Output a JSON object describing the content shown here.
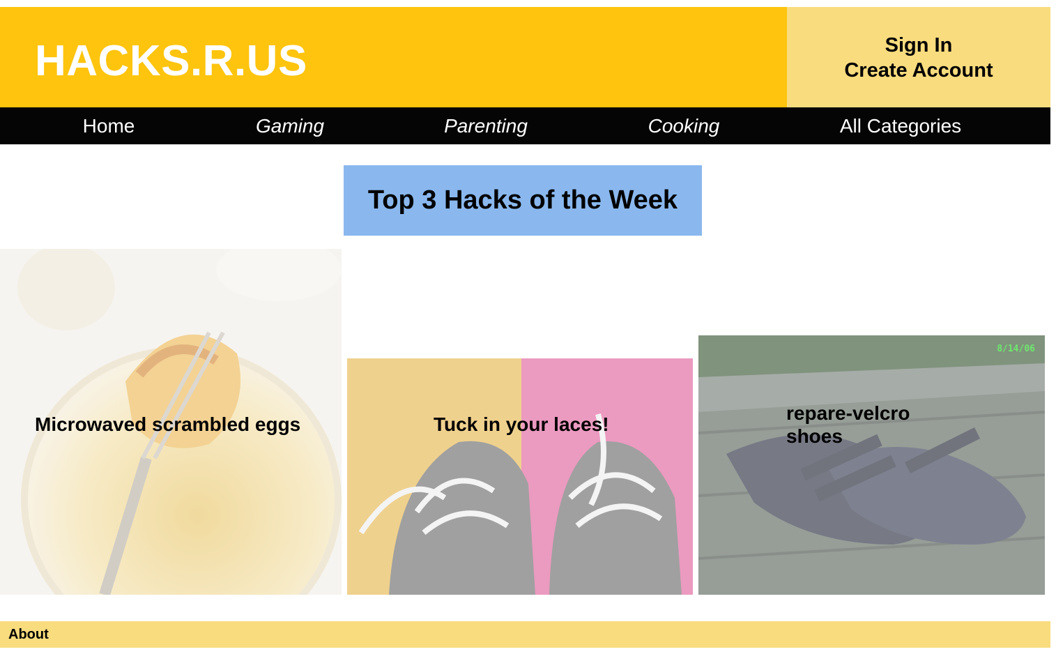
{
  "site": {
    "title": "HACKS.R.US"
  },
  "account": {
    "sign_in": "Sign In",
    "create_account": "Create Account"
  },
  "nav": {
    "home": "Home",
    "gaming": "Gaming",
    "parenting": "Parenting",
    "cooking": "Cooking",
    "all_categories": "All Categories"
  },
  "section": {
    "title": "Top 3 Hacks of the Week"
  },
  "hacks": [
    {
      "label": "Microwaved scrambled eggs"
    },
    {
      "label": "Tuck in your laces!"
    },
    {
      "label": "repare-velcro shoes"
    }
  ],
  "photo_stamp": "8/14/06",
  "footer": {
    "about": "About"
  },
  "colors": {
    "brand_bar": "#fec40e",
    "account_panel": "#f8dc7e",
    "nav_bar": "#050505",
    "section_title_bg": "#8ab8ee",
    "footer_bg": "#f8dc7e"
  }
}
